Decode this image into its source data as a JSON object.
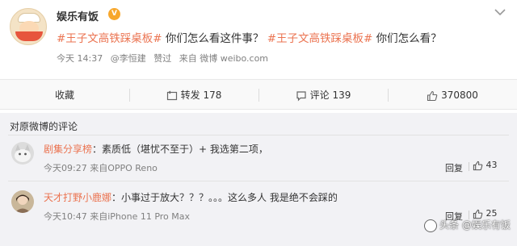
{
  "post": {
    "author": "娱乐有饭",
    "badge": "V",
    "content_topic1": "#王子文高铁踩桌板#",
    "content_text1": " 你们怎么看这件事？",
    "content_topic2": "#王子文高铁踩桌板#",
    "content_text2": " 你们怎么看？",
    "meta_time": "今天 14:37",
    "meta_from": "@李恒建",
    "meta_liked": "赞过",
    "meta_source": "来自 微博 weibo.com"
  },
  "actions": {
    "favorite": "收藏",
    "repost_label": "转发",
    "repost_count": "178",
    "comment_label": "评论",
    "comment_count": "139",
    "like_count": "370800"
  },
  "comments": {
    "title": "对原微博的评论",
    "items": [
      {
        "name": "剧集分享榜",
        "text": "：素质低（堪忧不至于）+ 我选第二项，",
        "time": "今天09:27",
        "source": "来自OPPO Reno",
        "reply": "回复",
        "likes": "43"
      },
      {
        "name": "天才打野小鹿娜",
        "text": "：小事过于放大？？？。。。这么多人 我是绝不会踩的",
        "time": "今天10:47",
        "source": "来自iPhone 11 Pro Max",
        "reply": "回复",
        "likes": "25"
      }
    ]
  },
  "watermark": "头条 @娱乐有饭",
  "colors": {
    "accent": "#eb7350",
    "badge": "#f7a72c"
  }
}
